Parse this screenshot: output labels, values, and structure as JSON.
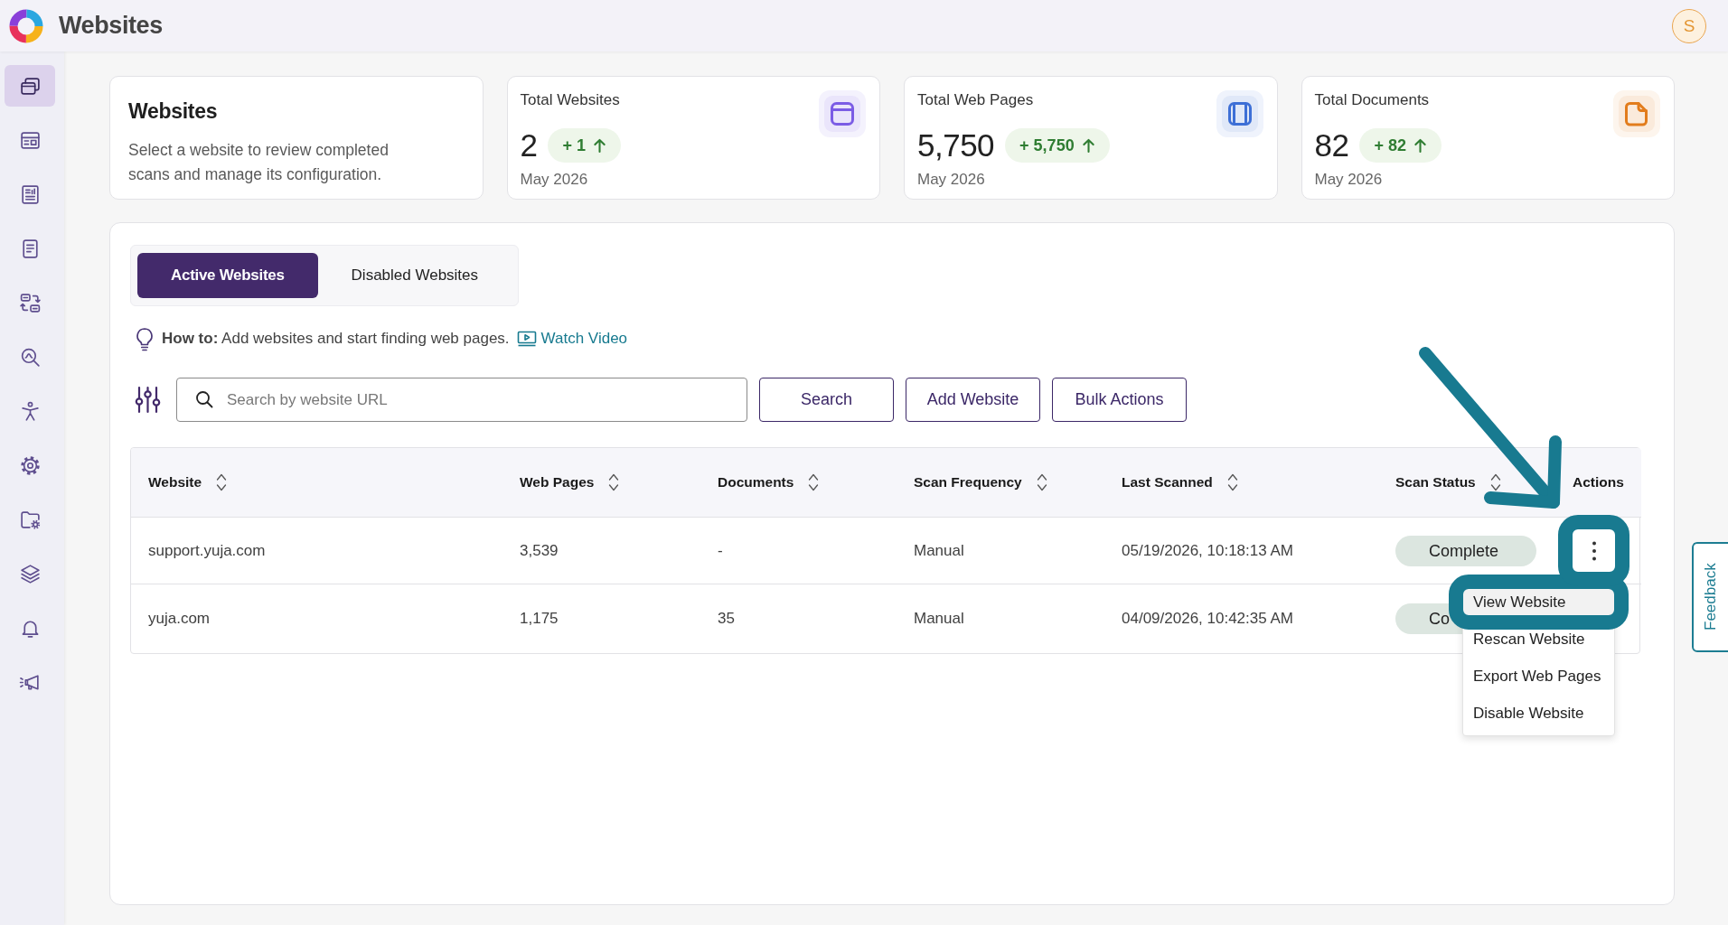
{
  "header": {
    "title": "Websites",
    "avatar": "S"
  },
  "sidebar": {
    "items": [
      {
        "selected": true
      },
      {
        "selected": false
      },
      {
        "selected": false
      },
      {
        "selected": false
      },
      {
        "selected": false
      },
      {
        "selected": false
      },
      {
        "selected": false
      },
      {
        "selected": false
      },
      {
        "selected": false
      },
      {
        "selected": false
      },
      {
        "selected": false
      },
      {
        "selected": false
      }
    ]
  },
  "intro": {
    "title": "Websites",
    "description": "Select a website to review completed scans and manage its configuration."
  },
  "stats": [
    {
      "title": "Total Websites",
      "value": "2",
      "change": "+ 1",
      "period": "May 2026",
      "color": "#7b5ce5"
    },
    {
      "title": "Total Web Pages",
      "value": "5,750",
      "change": "+ 5,750",
      "period": "May 2026",
      "color": "#3d6fd6"
    },
    {
      "title": "Total Documents",
      "value": "82",
      "change": "+ 82",
      "period": "May 2026",
      "color": "#e27c1c"
    }
  ],
  "tabs": [
    {
      "label": "Active Websites",
      "selected": true
    },
    {
      "label": "Disabled Websites",
      "selected": false
    }
  ],
  "how_to": {
    "text": "**How to:** Add websites and start finding web pages.",
    "link": "Watch Video"
  },
  "search": {
    "placeholder": "Search by website URL"
  },
  "buttons": [
    "Search",
    "Add Website",
    "Bulk Actions"
  ],
  "table": {
    "columns": [
      {
        "label": "Website",
        "sortable": true
      },
      {
        "label": "Web Pages",
        "sortable": true
      },
      {
        "label": "Documents",
        "sortable": true
      },
      {
        "label": "Scan Frequency",
        "sortable": true
      },
      {
        "label": "Last Scanned",
        "sortable": true
      },
      {
        "label": "Scan Status",
        "sortable": true
      },
      {
        "label": "Actions",
        "sortable": false
      }
    ],
    "rows": [
      {
        "cells": [
          "support.yuja.com",
          "3,539",
          "-",
          "Manual",
          "05/19/2026, 10:18:13 AM"
        ],
        "status": "Complete",
        "actions": {
          "outlined": true,
          "menu": [
            {
              "label": "View Website",
              "selected": true,
              "outlined": true
            },
            {
              "label": "Rescan Website",
              "selected": false,
              "outlined": false
            },
            {
              "label": "Export Web Pages",
              "selected": false,
              "outlined": false
            },
            {
              "label": "Disable Website",
              "selected": false,
              "outlined": false
            }
          ]
        }
      },
      {
        "cells": [
          "yuja.com",
          "1,175",
          "35",
          "Manual",
          "04/09/2026, 10:42:35 AM"
        ],
        "status": "Co"
      }
    ]
  },
  "annotations": [
    {
      "kind": "arrow"
    }
  ],
  "feedback": {
    "label": "Feedback"
  }
}
